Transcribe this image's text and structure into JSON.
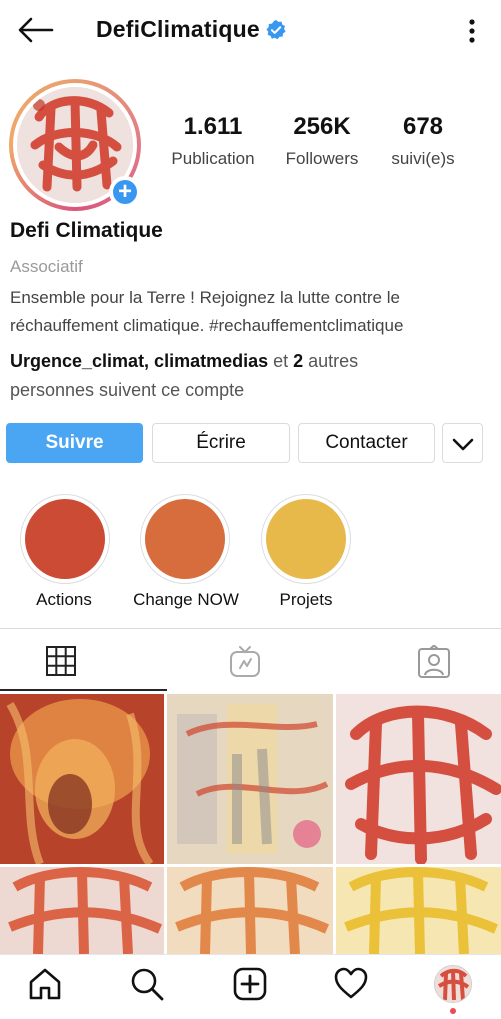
{
  "header": {
    "username": "DefiClimatique"
  },
  "profile": {
    "stats": [
      {
        "value": "1.611",
        "label": "Publication"
      },
      {
        "value": "256K",
        "label": "Followers"
      },
      {
        "value": "678",
        "label": "suivi(e)s"
      }
    ],
    "display_name": "Defi Climatique",
    "category": "Associatif",
    "bio_line1": "Ensemble pour la Terre ! Rejoignez la lutte contre le",
    "bio_line2": "réchauffement climatique. #rechauffementclimatique",
    "followed_by_names": "Urgence_climat, climatmedias",
    "followed_by_and": " et ",
    "followed_by_count": "2",
    "followed_by_rest1": " autres",
    "followed_by_rest2": "personnes suivent ce compte"
  },
  "actions": {
    "follow_label": "Suivre",
    "write_label": "Écrire",
    "contact_label": "Contacter"
  },
  "highlights": [
    {
      "label": "Actions",
      "color": "#cc4b35"
    },
    {
      "label": "Change NOW",
      "color": "#d76c3c"
    },
    {
      "label": "Projets",
      "color": "#e6b94a"
    }
  ],
  "tabs": [
    {
      "icon": "grid-icon",
      "active": true
    },
    {
      "icon": "igtv-icon",
      "active": false
    },
    {
      "icon": "tagged-icon",
      "active": false
    }
  ],
  "colors": {
    "accent": "#4aa5f2",
    "verified": "#3897f0",
    "notification_dot": "#ed4956"
  },
  "bottom_nav": [
    "home-icon",
    "search-icon",
    "new-post-icon",
    "activity-heart-icon",
    "profile-avatar"
  ]
}
